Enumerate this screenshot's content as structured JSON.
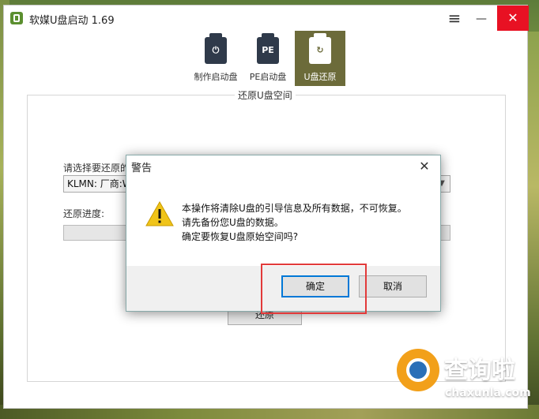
{
  "window": {
    "title": "软媒U盘启动 1.69"
  },
  "tabs": [
    {
      "label": "制作启动盘",
      "icon": "power-usb-icon",
      "glyph": "⏻"
    },
    {
      "label": "PE启动盘",
      "icon": "pe-usb-icon",
      "glyph": "PE"
    },
    {
      "label": "U盘还原",
      "icon": "restore-usb-icon",
      "glyph": "↻",
      "active": true
    }
  ],
  "panel": {
    "title": "还原U盘空间",
    "select_label": "请选择要还原的",
    "select_value": "KLMN: 厂商:W",
    "progress_label": "还原进度:",
    "progress_value": 0,
    "restore_button": "还原"
  },
  "dialog": {
    "title": "警告",
    "lines": [
      "本操作将清除U盘的引导信息及所有数据，不可恢复。",
      "请先备份您U盘的数据。",
      "确定要恢复U盘原始空间吗?"
    ],
    "ok_label": "确定",
    "cancel_label": "取消"
  },
  "watermark": {
    "text": "查询啦",
    "sub": "chaxunla.com"
  },
  "colors": {
    "active_tab": "#6c6b3a",
    "close_button": "#e81123",
    "highlight_border": "#e23a3a",
    "warning_icon": "#f0c419"
  }
}
